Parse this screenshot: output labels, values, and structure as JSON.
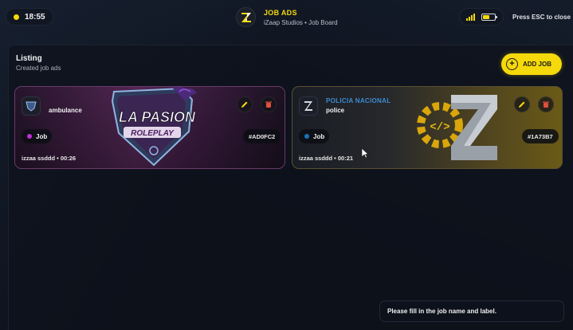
{
  "header": {
    "time": "18:55",
    "title": "JOB ADS",
    "subtitle": "iZaap Studios • Job Board",
    "esc_hint": "Press ESC to close",
    "battery_fraction": 0.6
  },
  "listing": {
    "title": "Listing",
    "subtitle": "Created job ads",
    "add_button_label": "ADD JOB"
  },
  "cards": [
    {
      "company": "",
      "name": "ambulance",
      "type_label": "Job",
      "color_code": "#AD0FC2",
      "meta": "izzaa ssddd • 00:26",
      "art_text_line1": "LA PASION",
      "art_text_line2": "ROLEPLAY"
    },
    {
      "company": "POLICIA NACIONAL",
      "name": "police",
      "type_label": "Job",
      "color_code": "#1A73B7",
      "meta": "izzaa ssddd • 00:21"
    }
  ],
  "toast": {
    "message": "Please fill in the job name and label."
  },
  "colors": {
    "accent": "#f5d90a",
    "panel_bg": "#0b1019",
    "card_a_dot": "#c12fd6",
    "card_b_dot": "#1a73b7",
    "link_blue": "#3d8bd4"
  },
  "icons": {
    "edit": "pencil-icon",
    "delete": "trash-icon",
    "add": "plus-icon",
    "signal": "signal-icon",
    "battery": "battery-icon"
  }
}
